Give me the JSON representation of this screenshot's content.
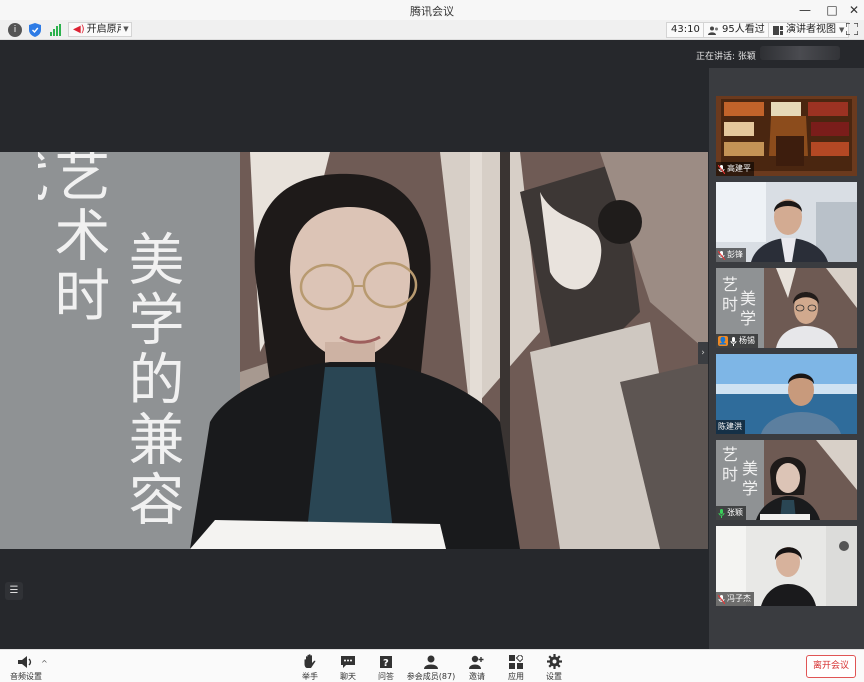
{
  "window": {
    "title": "腾讯会议",
    "minimize": "—",
    "maximize": "□",
    "close": "✕"
  },
  "toolbar": {
    "info_icon": "info-icon",
    "shield_icon": "shield-icon",
    "signal_icon": "signal-icon",
    "record_label": "开启原声",
    "timer": "43:10",
    "viewers": "95人看过",
    "view_mode": "演讲者视图",
    "colors": {
      "shield": "#2d7be5",
      "signal": "#2bb24c",
      "record": "#dd2233"
    }
  },
  "stage": {
    "speaking_prefix": "正在讲话:",
    "speaking_name": "张颖",
    "slide_text_left": "艺术时代：",
    "slide_text_right": "美学的兼容"
  },
  "participants": [
    {
      "name": "高建平",
      "mic": "muted"
    },
    {
      "name": "彭锋",
      "mic": "muted"
    },
    {
      "name": "杨锡",
      "mic": "on"
    },
    {
      "name": "陈建洪",
      "mic": "none"
    },
    {
      "name": "张颖",
      "mic": "active"
    },
    {
      "name": "冯子杰",
      "mic": "muted"
    }
  ],
  "bottombar": {
    "audio_settings": "音频设置",
    "raise_hand": "举手",
    "chat": "聊天",
    "qa": "问答",
    "members": "参会成员(87)",
    "invite": "邀请",
    "apps": "应用",
    "settings": "设置",
    "leave": "离开会议",
    "leave_color": "#d63030"
  }
}
